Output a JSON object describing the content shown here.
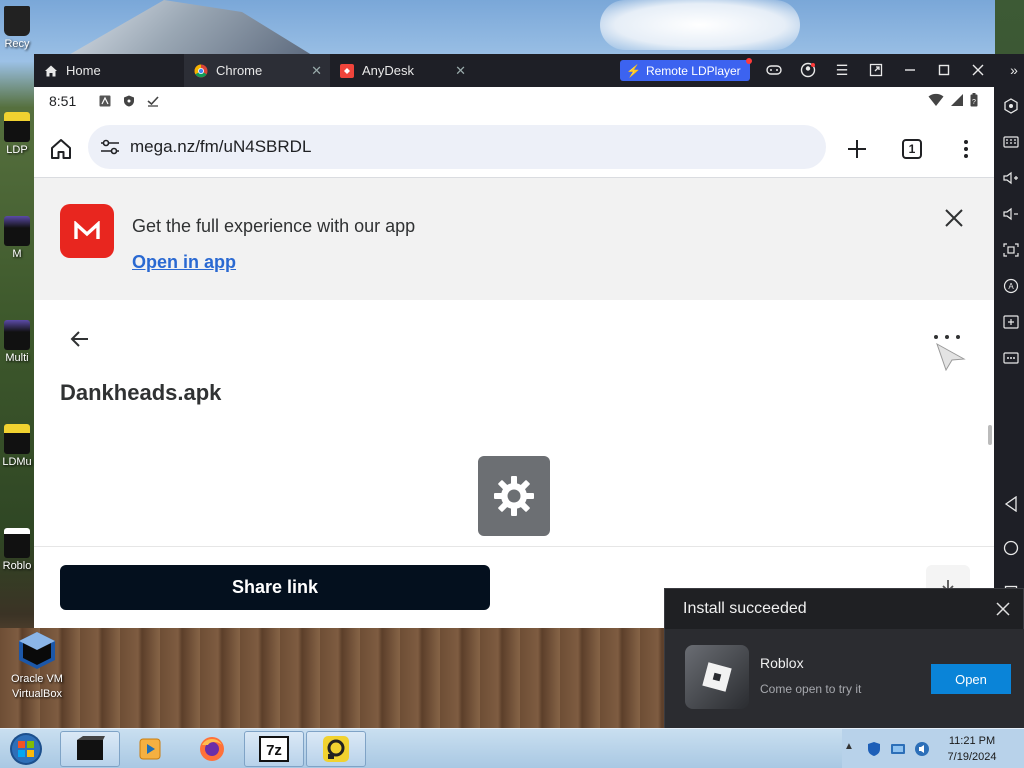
{
  "desktop": {
    "icons": [
      {
        "label": "Recy"
      },
      {
        "label": "LDP"
      },
      {
        "label": "M"
      },
      {
        "label": "Multi"
      },
      {
        "label": "LDMu"
      },
      {
        "label": "Roblo"
      }
    ],
    "virtualbox_label_1": "Oracle VM",
    "virtualbox_label_2": "VirtualBox"
  },
  "ldplayer": {
    "tabs": [
      {
        "label": "Home",
        "icon": "home-icon"
      },
      {
        "label": "Chrome",
        "icon": "chrome-icon"
      },
      {
        "label": "AnyDesk",
        "icon": "anydesk-icon"
      }
    ],
    "remote_button": "Remote LDPlayer",
    "accent": "#3c63f0"
  },
  "android": {
    "status": {
      "time": "8:51"
    },
    "url": "mega.nz/fm/uN4SBRDL",
    "tab_count": "1",
    "banner": {
      "text": "Get the full experience with our app",
      "link": "Open in app"
    },
    "file": {
      "name": "Dankheads.apk"
    },
    "share_button": "Share link",
    "mega_color": "#e8261f"
  },
  "notification": {
    "title": "Install succeeded",
    "app_name": "Roblox",
    "subtitle": "Come open to try it",
    "open_button": "Open"
  },
  "taskbar": {
    "time": "11:21 PM",
    "date": "7/19/2024"
  }
}
